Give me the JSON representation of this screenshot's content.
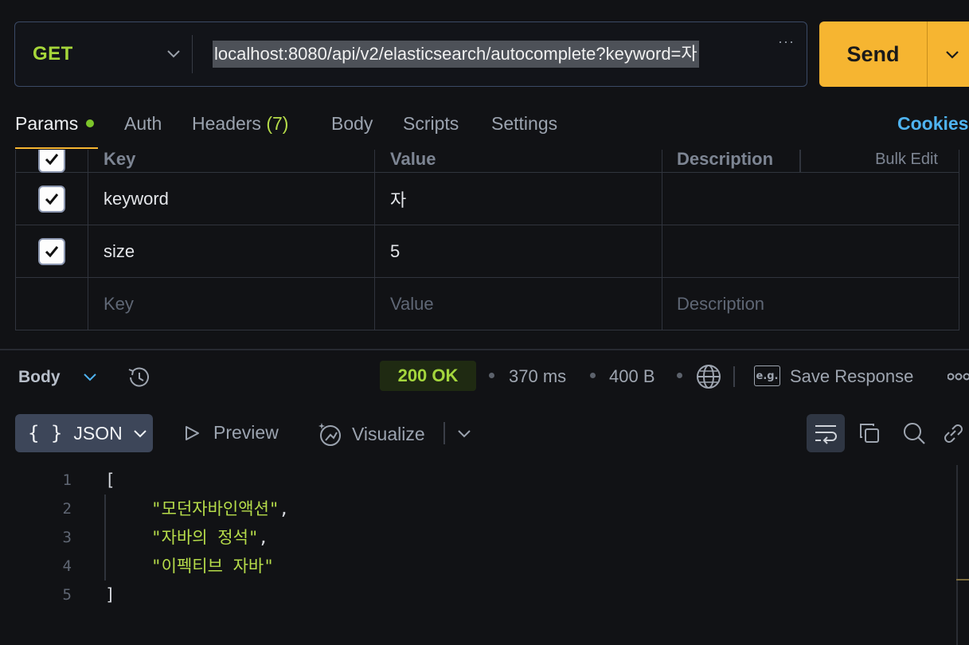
{
  "request": {
    "method": "GET",
    "url": "localhost:8080/api/v2/elasticsearch/autocomplete?keyword=자",
    "url_more": "···",
    "send_label": "Send"
  },
  "tabs": {
    "params": "Params",
    "auth": "Auth",
    "headers": "Headers",
    "headers_count": "(7)",
    "body": "Body",
    "scripts": "Scripts",
    "settings": "Settings",
    "cookies": "Cookies"
  },
  "params": {
    "columns": {
      "key": "Key",
      "value": "Value",
      "description": "Description",
      "bulk_edit": "Bulk Edit"
    },
    "rows": [
      {
        "key": "keyword",
        "value": "자",
        "description": "",
        "checked": true
      },
      {
        "key": "size",
        "value": "5",
        "description": "",
        "checked": true
      }
    ],
    "placeholder": {
      "key": "Key",
      "value": "Value",
      "description": "Description"
    }
  },
  "response": {
    "body_label": "Body",
    "status": "200 OK",
    "time": "370 ms",
    "size": "400 B",
    "save_label": "Save Response",
    "eg_label": "e.g."
  },
  "view": {
    "json_label": "JSON",
    "json_braces": "{ }",
    "preview_label": "Preview",
    "visualize_label": "Visualize"
  },
  "code": {
    "lines": [
      {
        "num": "1",
        "text": "["
      },
      {
        "num": "2",
        "text": "\"모던자바인액션\"",
        "suffix": ","
      },
      {
        "num": "3",
        "text": "\"자바의 정석\"",
        "suffix": ","
      },
      {
        "num": "4",
        "text": "\"이펙티브 자바\"",
        "suffix": ""
      },
      {
        "num": "5",
        "text": "]"
      }
    ]
  },
  "colors": {
    "accent": "#f6b531",
    "method": "#a6d63a",
    "string": "#b6dc4a",
    "cookies": "#4fb3f0"
  }
}
